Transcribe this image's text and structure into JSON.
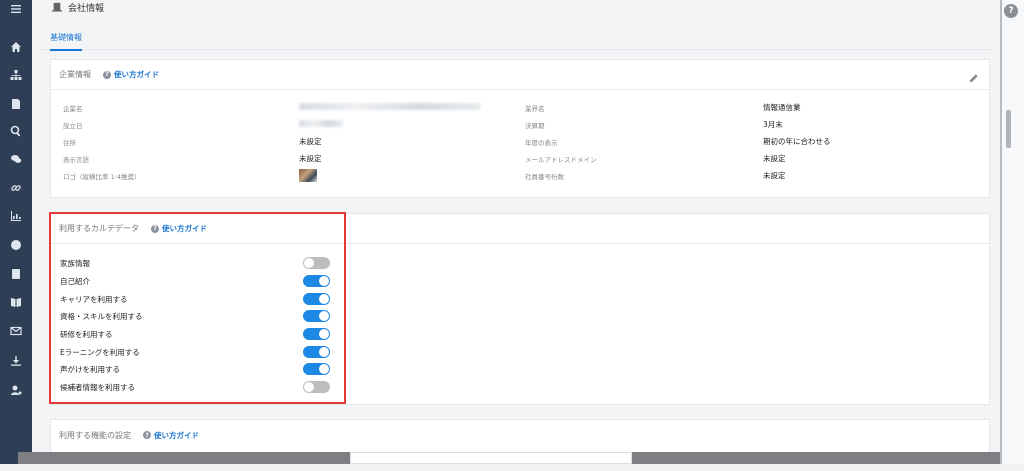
{
  "page": {
    "title": "会社情報"
  },
  "tabs": [
    {
      "label": "基礎情報"
    }
  ],
  "company_card": {
    "title": "企業情報",
    "guide": "使い方ガイド",
    "left_fields": [
      {
        "label": "企業名",
        "value": ""
      },
      {
        "label": "設立日",
        "value": ""
      },
      {
        "label": "住所",
        "value": "未設定"
      },
      {
        "label": "表示言語",
        "value": "未設定"
      },
      {
        "label": "ロゴ（縦横比率 1:4推奨）",
        "value": ""
      }
    ],
    "right_fields": [
      {
        "label": "業界名",
        "value": "情報通信業"
      },
      {
        "label": "決算期",
        "value": "3月末"
      },
      {
        "label": "年度の表示",
        "value": "期初の年に合わせる"
      },
      {
        "label": "メールアドレスドメイン",
        "value": "未設定"
      },
      {
        "label": "社員番号桁数",
        "value": "未設定"
      }
    ]
  },
  "karte_card": {
    "title": "利用するカルテデータ",
    "guide": "使い方ガイド",
    "items": [
      {
        "label": "家族情報",
        "enabled": false
      },
      {
        "label": "自己紹介",
        "enabled": true
      },
      {
        "label": "キャリアを利用する",
        "enabled": true
      },
      {
        "label": "資格・スキルを利用する",
        "enabled": true
      },
      {
        "label": "研修を利用する",
        "enabled": true
      },
      {
        "label": "Eラーニングを利用する",
        "enabled": true
      },
      {
        "label": "声がけを利用する",
        "enabled": true
      },
      {
        "label": "候補者情報を利用する",
        "enabled": false
      }
    ]
  },
  "feature_card": {
    "title": "利用する機能の設定",
    "guide": "使い方ガイド"
  },
  "help": {
    "label": "?"
  },
  "sidebar": {
    "icons": [
      "menu-icon",
      "home-icon",
      "org-chart-icon",
      "document-icon",
      "search-icon",
      "chat-icon",
      "link-icon",
      "chart-icon",
      "globe-icon",
      "contact-card-icon",
      "book-icon",
      "mail-icon",
      "download-icon",
      "user-settings-icon"
    ]
  },
  "colors": {
    "accent": "#1976d2",
    "toggle_on": "#1e88e5",
    "toggle_off": "#bdbdbd",
    "sidebar": "#2d3e55",
    "highlight": "#e53935"
  }
}
